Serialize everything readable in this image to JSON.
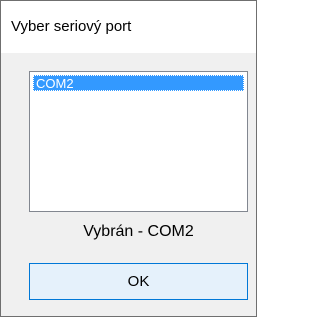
{
  "window": {
    "title": "Vyber seriový port"
  },
  "ports": {
    "items": [
      "COM2"
    ],
    "selected": "COM2"
  },
  "status": {
    "text": "Vybrán - COM2"
  },
  "buttons": {
    "ok_label": "OK"
  },
  "colors": {
    "selection": "#3399ff",
    "button_border": "#0078d7",
    "button_bg": "#e5f1fb",
    "dialog_bg": "#f0f0f0"
  }
}
